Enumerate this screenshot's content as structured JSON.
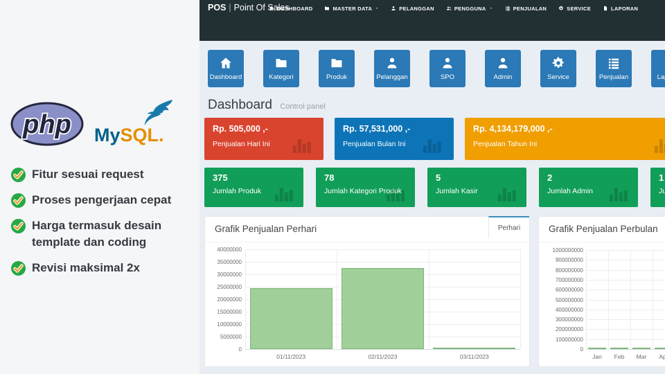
{
  "left_panel": {
    "php_logo_text": "php",
    "mysql_logo_my": "My",
    "mysql_logo_sql": "SQL",
    "mysql_logo_dot": ".",
    "features": [
      "Fitur sesuai request",
      "Proses pengerjaan cepat",
      "Harga termasuk desain template dan coding",
      "Revisi maksimal 2x"
    ]
  },
  "navbar": {
    "brand_bold": "POS",
    "brand_sep": "|",
    "brand_name": "Point Of Sales",
    "items": [
      {
        "label": "DASHBOARD",
        "icon": "home",
        "caret": false
      },
      {
        "label": "MASTER DATA",
        "icon": "folder",
        "caret": true
      },
      {
        "label": "PELANGGAN",
        "icon": "user",
        "caret": false
      },
      {
        "label": "PENGGUNA",
        "icon": "users",
        "caret": true
      },
      {
        "label": "PENJUALAN",
        "icon": "list",
        "caret": false
      },
      {
        "label": "SERVICE",
        "icon": "gear",
        "caret": false
      },
      {
        "label": "LAPORAN",
        "icon": "file",
        "caret": false
      }
    ]
  },
  "shortcuts": [
    {
      "label": "Dashboard",
      "icon": "home"
    },
    {
      "label": "Kategori",
      "icon": "folder"
    },
    {
      "label": "Produk",
      "icon": "folder"
    },
    {
      "label": "Pelanggan",
      "icon": "user"
    },
    {
      "label": "SPO",
      "icon": "user"
    },
    {
      "label": "Admin",
      "icon": "user"
    },
    {
      "label": "Service",
      "icon": "gear"
    },
    {
      "label": "Penjualan",
      "icon": "list"
    },
    {
      "label": "Laporan",
      "icon": "file"
    }
  ],
  "page_header": {
    "title": "Dashboard",
    "subtitle": "Control panel"
  },
  "stat_cards": [
    {
      "value": "Rp. 505,000 ,-",
      "label": "Penjualan Hari Ini",
      "color": "#d9442f"
    },
    {
      "value": "Rp. 57,531,000 ,-",
      "label": "Penjualan Bulan Ini",
      "color": "#0d74b7"
    },
    {
      "value": "Rp. 4,134,179,000 ,-",
      "label": "Penjualan Tahun Ini",
      "color": "#f09e00"
    }
  ],
  "count_cards": [
    {
      "value": "375",
      "label": "Jumlah Produk",
      "color": "#119e58"
    },
    {
      "value": "78",
      "label": "Jumlah Kategori Produk",
      "color": "#119e58"
    },
    {
      "value": "5",
      "label": "Jumlah Kasir",
      "color": "#119e58"
    },
    {
      "value": "2",
      "label": "Jumlah Admin",
      "color": "#119e58"
    },
    {
      "value": "1",
      "label": "Jum",
      "color": "#119e58"
    }
  ],
  "chart_data": [
    {
      "type": "bar",
      "title": "Grafik Penjualan Perhari",
      "tab": "Perhari",
      "categories": [
        "01/11/2023",
        "02/11/2023",
        "03/11/2023"
      ],
      "values": [
        24500000,
        32526000,
        505000
      ],
      "xlabel": "",
      "ylabel": "",
      "ylim": [
        0,
        40000000
      ],
      "ytick_step": 5000000,
      "grid": true,
      "legend": "none"
    },
    {
      "type": "bar",
      "title": "Grafik Penjualan Perbulan",
      "categories": [
        "Jan",
        "Feb",
        "Mar",
        "Apr"
      ],
      "values": [
        4000000,
        4000000,
        4000000,
        4000000
      ],
      "xlabel": "",
      "ylabel": "",
      "ylim": [
        0,
        1000000000
      ],
      "ytick_step": 100000000,
      "grid": true,
      "legend": "none"
    }
  ],
  "colors": {
    "navbar_bg": "#223034",
    "app_bg": "#e9eef4",
    "left_bg": "#f5f6f8",
    "shortcut_blue": "#2b79b6",
    "tab_accent": "#3c8dbc",
    "bar_fill": "#a0cf99",
    "bar_border": "#7cb678",
    "count_green": "#119e58"
  }
}
